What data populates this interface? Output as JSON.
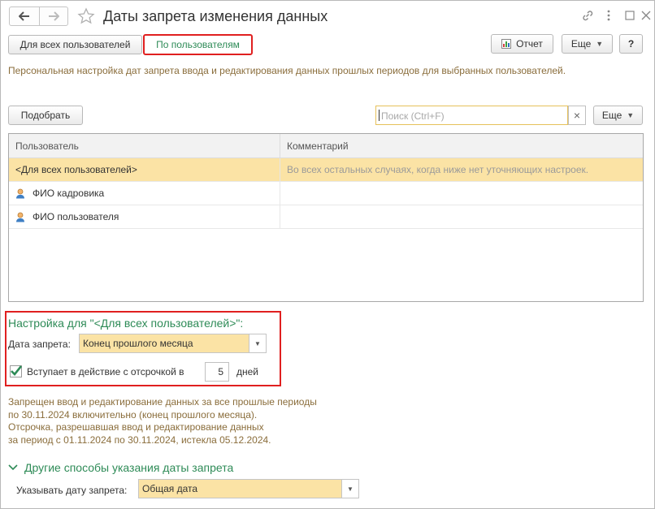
{
  "window": {
    "title": "Даты запрета изменения данных",
    "icons": [
      "link-icon",
      "more-vert-icon",
      "maximize-icon",
      "close-icon"
    ]
  },
  "mode_switch": {
    "all_users": "Для всех пользователей",
    "by_users": "По пользователям"
  },
  "toolbar": {
    "report": "Отчет",
    "more": "Еще",
    "help": "?"
  },
  "description": "Персональная настройка дат запрета ввода и редактирования данных прошлых периодов для выбранных пользователей.",
  "list_toolbar": {
    "pick": "Подобрать",
    "search_placeholder": "Поиск (Ctrl+F)",
    "clear": "×",
    "more": "Еще"
  },
  "table": {
    "columns": [
      "Пользователь",
      "Комментарий"
    ],
    "rows": [
      {
        "user": "<Для всех пользователей>",
        "comment": "Во всех остальных случаях, когда ниже нет уточняющих настроек.",
        "icon": ""
      },
      {
        "user": "ФИО кадровика",
        "comment": "",
        "icon": "user-icon"
      },
      {
        "user": "ФИО пользователя",
        "comment": "",
        "icon": "user-icon"
      }
    ]
  },
  "settings": {
    "header": "Настройка для \"<Для всех пользователей>\":",
    "date_label": "Дата запрета:",
    "date_value": "Конец прошлого месяца",
    "delay_checked": true,
    "delay_label": "Вступает в действие с отсрочкой в",
    "delay_value": "5",
    "delay_unit": "дней"
  },
  "info_lines": [
    "Запрещен ввод и редактирование данных за все прошлые периоды",
    "по 30.11.2024 включительно (конец прошлого месяца).",
    "Отсрочка, разрешавшая ввод и редактирование данных",
    "за период с 01.11.2024 по 30.11.2024, истекла 05.12.2024."
  ],
  "other_methods": {
    "header": "Другие способы указания даты запрета",
    "label": "Указывать дату запрета:",
    "value": "Общая дата"
  },
  "colors": {
    "accent_green": "#2e8b57",
    "highlight": "#e02020",
    "selection": "#fbe3a5"
  }
}
